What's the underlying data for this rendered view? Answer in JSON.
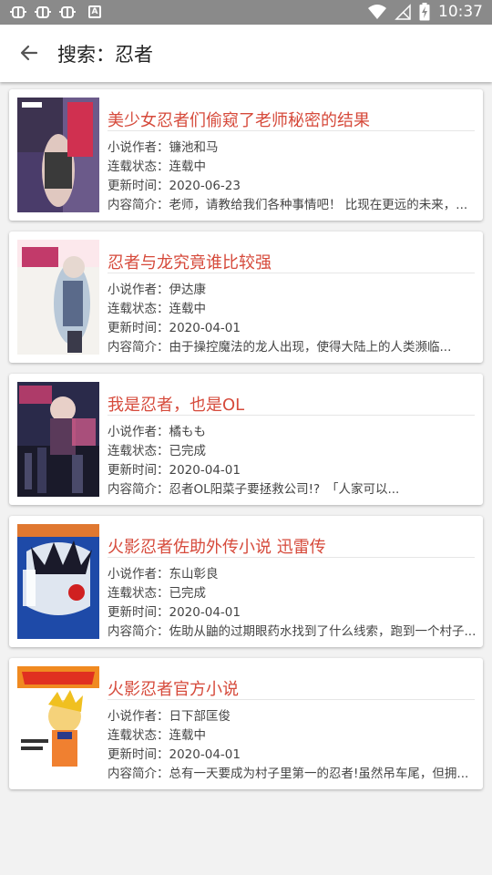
{
  "status_bar": {
    "time": "10:37",
    "notification_text": "A"
  },
  "header": {
    "title": "搜索：忍者"
  },
  "labels": {
    "author": "小说作者：",
    "status": "连载状态：",
    "updated": "更新时间：",
    "summary": "内容简介："
  },
  "books": [
    {
      "title": "美少女忍者们偷窥了老师秘密的结果",
      "author": "镰池和马",
      "status": "连载中",
      "updated": "2020-06-23",
      "summary": "老师，请教给我们各种事情吧！ 比现在更远的未来，..."
    },
    {
      "title": "忍者与龙究竟谁比较强",
      "author": "伊达康",
      "status": "连载中",
      "updated": "2020-04-01",
      "summary": "由于操控魔法的龙人出现，使得大陆上的人类濒临..."
    },
    {
      "title": "我是忍者，也是OL",
      "author": "橘もも",
      "status": "已完成",
      "updated": "2020-04-01",
      "summary": "忍者OL阳菜子要拯救公司!?　「人家可以..."
    },
    {
      "title": "火影忍者佐助外传小说 迅雷传",
      "author": "东山彰良",
      "status": "已完成",
      "updated": "2020-04-01",
      "summary": "佐助从鼬的过期眼药水找到了什么线索，跑到一个村子..."
    },
    {
      "title": "火影忍者官方小说",
      "author": "日下部匡俊",
      "status": "连载中",
      "updated": "2020-04-01",
      "summary": "总有一天要成为村子里第一的忍者!虽然吊车尾，但拥..."
    }
  ]
}
